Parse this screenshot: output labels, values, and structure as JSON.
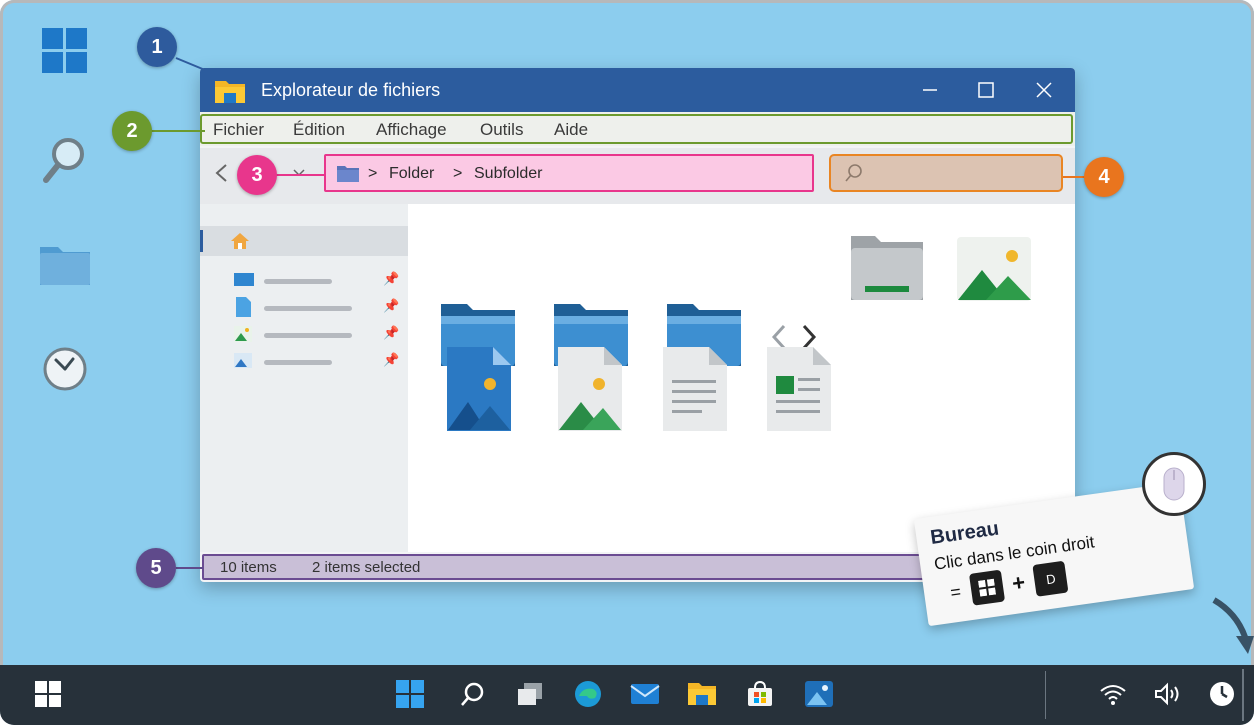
{
  "window": {
    "title": "Explorateur de fichiers"
  },
  "menu": {
    "items": [
      "Fichier",
      "Édition",
      "Affichage",
      "Outils",
      "Aide"
    ]
  },
  "address": {
    "crumbs": [
      "Folder",
      "Subfolder"
    ],
    "separator": ">"
  },
  "status": {
    "item_count": "10 items",
    "selection": "2 items selected"
  },
  "callouts": [
    {
      "label": "1",
      "color": "#2e5b9d"
    },
    {
      "label": "2",
      "color": "#6c9a2e"
    },
    {
      "label": "3",
      "color": "#e8368c"
    },
    {
      "label": "4",
      "color": "#e9751e"
    },
    {
      "label": "5",
      "color": "#5f4a8b"
    }
  ],
  "note": {
    "title": "Bureau",
    "line": "Clic dans le coin droit",
    "equals": "=",
    "plus": "+",
    "key2": "D"
  },
  "colors": {
    "desktop": "#8ccdee",
    "titlebar": "#2c5c9e",
    "taskbar": "#27313a",
    "folder": "#2d79b6"
  },
  "icons": {
    "desktop": [
      "windows-logo-icon",
      "search-icon",
      "folder-icon",
      "clock-icon"
    ],
    "taskbar_center": [
      "start-icon",
      "search-icon",
      "task-view-icon",
      "edge-icon",
      "mail-icon",
      "file-explorer-icon",
      "store-icon",
      "photos-icon"
    ],
    "tray": [
      "wifi-icon",
      "volume-icon",
      "clock-icon"
    ]
  }
}
